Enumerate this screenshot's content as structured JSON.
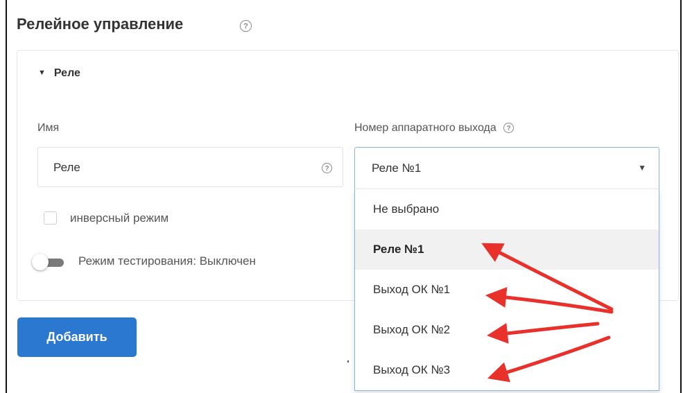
{
  "page": {
    "title": "Релейное управление",
    "title_help": "?"
  },
  "section": {
    "caret": "▼",
    "title": "Реле"
  },
  "name_field": {
    "label": "Имя",
    "value": "Реле",
    "help": "?"
  },
  "output_field": {
    "label": "Номер аппаратного выхода",
    "help": "?",
    "selected": "Реле №1",
    "chevron": "▼",
    "options": [
      {
        "label": "Не выбрано"
      },
      {
        "label": "Реле №1",
        "selected": true
      },
      {
        "label": "Выход ОК №1"
      },
      {
        "label": "Выход ОК №2"
      },
      {
        "label": "Выход ОК №3"
      }
    ]
  },
  "inverse_mode": {
    "label": "инверсный режим",
    "checked": false
  },
  "test_mode": {
    "label": "Режим тестирования: Выключен",
    "on": false
  },
  "add_button": {
    "label": "Добавить"
  },
  "colors": {
    "accent": "#2b78d0",
    "arrow": "#e8312a",
    "select_border": "#88b3e0"
  }
}
